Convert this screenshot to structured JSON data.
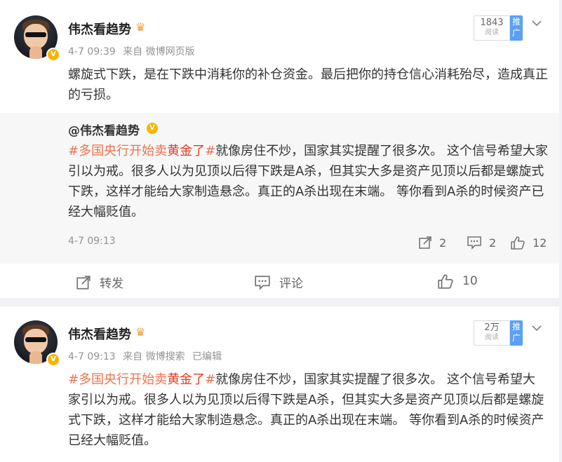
{
  "colors": {
    "topic": "#eb7350",
    "topic_red": "#e63a20",
    "promo": "#5aa0f5",
    "vip_badge": "#f7b500"
  },
  "posts": [
    {
      "author": "伟杰看趋势",
      "time": "4-7 09:39",
      "source": "来自 微博网页版",
      "edited": "",
      "read_count": "1843",
      "read_label": "阅读",
      "promo_label": "推广",
      "text": "螺旋式下跌，是在下跌中消耗你的补仓资金。最后把你的持仓信心消耗殆尽，造成真正的亏损。",
      "repost": {
        "author": "@伟杰看趋势",
        "topic_prefix": "#多国央行开始卖",
        "topic_highlight": "黄金了",
        "topic_suffix": "#",
        "body": "就像房住不炒，国家其实提醒了很多次。 这个信号希望大家引以为戒。很多人以为见顶以后得下跌是A杀，但其实大多是资产见顶以后都是螺旋式下跌，这样才能给大家制造悬念。真正的A杀出现在末端。 等你看到A杀的时候资产已经大幅贬值。",
        "time": "4-7 09:13",
        "shares": "2",
        "comments": "2",
        "likes": "12"
      },
      "actions": {
        "repost": "转发",
        "comment": "评论",
        "like_count": "10"
      }
    },
    {
      "author": "伟杰看趋势",
      "time": "4-7 09:13",
      "source": "来自 微博搜索",
      "edited": "已编辑",
      "read_count": "2万",
      "read_label": "阅读",
      "promo_label": "推广",
      "topic_prefix": "#多国央行开始卖",
      "topic_highlight": "黄金了",
      "topic_suffix": "#",
      "body": "就像房住不炒，国家其实提醒了很多次。 这个信号希望大家引以为戒。很多人以为见顶以后得下跌是A杀，但其实大多是资产见顶以后都是螺旋式下跌，这样才能给大家制造悬念。真正的A杀出现在末端。 等你看到A杀的时候资产已经大幅贬值。"
    }
  ]
}
